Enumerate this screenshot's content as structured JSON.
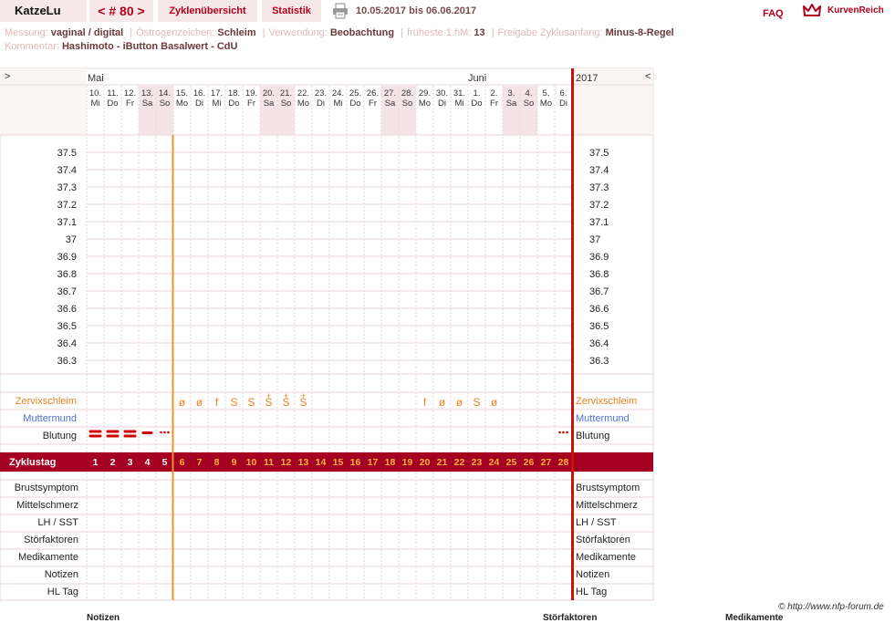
{
  "header": {
    "user": "KatzeLu",
    "cycle_nav": "< # 80 >",
    "tabs": [
      "Zyklenübersicht",
      "Statistik"
    ],
    "date_range": "10.05.2017 bis 06.06.2017",
    "faq": "FAQ",
    "brand": "KurvenReich",
    "printer_icon": "printer-icon",
    "crown_icon": "crown-icon"
  },
  "meta": {
    "line1": [
      {
        "key": "Messung:",
        "value": "vaginal / digital"
      },
      {
        "key": "Östrogenzeichen:",
        "value": "Schleim"
      },
      {
        "key": "Verwendung:",
        "value": "Beobachtung"
      },
      {
        "key": "früheste 1.hM:",
        "value": "13"
      },
      {
        "key": "Freigabe Zyklusanfang:",
        "value": "Minus-8-Regel"
      }
    ],
    "line2": [
      {
        "key": "Kommentar:",
        "value": "Hashimoto - iButton Basalwert - CdU"
      }
    ]
  },
  "chart": {
    "nav_left": ">",
    "nav_right": "<",
    "year": "2017",
    "month_may": "Mai",
    "month_june": "Juni",
    "days": [
      {
        "d": "10.",
        "w": "Mi",
        "we": false
      },
      {
        "d": "11.",
        "w": "Do",
        "we": false
      },
      {
        "d": "12.",
        "w": "Fr",
        "we": false
      },
      {
        "d": "13.",
        "w": "Sa",
        "we": true
      },
      {
        "d": "14.",
        "w": "So",
        "we": true
      },
      {
        "d": "15.",
        "w": "Mo",
        "we": false
      },
      {
        "d": "16.",
        "w": "Di",
        "we": false
      },
      {
        "d": "17.",
        "w": "Mi",
        "we": false
      },
      {
        "d": "18.",
        "w": "Do",
        "we": false
      },
      {
        "d": "19.",
        "w": "Fr",
        "we": false
      },
      {
        "d": "20.",
        "w": "Sa",
        "we": true
      },
      {
        "d": "21.",
        "w": "So",
        "we": true
      },
      {
        "d": "22.",
        "w": "Mo",
        "we": false
      },
      {
        "d": "23.",
        "w": "Di",
        "we": false
      },
      {
        "d": "24.",
        "w": "Mi",
        "we": false
      },
      {
        "d": "25.",
        "w": "Do",
        "we": false
      },
      {
        "d": "26.",
        "w": "Fr",
        "we": false
      },
      {
        "d": "27.",
        "w": "Sa",
        "we": true
      },
      {
        "d": "28.",
        "w": "So",
        "we": true
      },
      {
        "d": "29.",
        "w": "Mo",
        "we": false
      },
      {
        "d": "30.",
        "w": "Di",
        "we": false
      },
      {
        "d": "31.",
        "w": "Mi",
        "we": false
      },
      {
        "d": "1.",
        "w": "Do",
        "we": false
      },
      {
        "d": "2.",
        "w": "Fr",
        "we": false
      },
      {
        "d": "3.",
        "w": "Sa",
        "we": true
      },
      {
        "d": "4.",
        "w": "So",
        "we": true
      },
      {
        "d": "5.",
        "w": "Mo",
        "we": false
      },
      {
        "d": "6.",
        "w": "Di",
        "we": false
      }
    ],
    "temp_scale": [
      "37.5",
      "37.4",
      "37.3",
      "37.2",
      "37.1",
      "37",
      "36.9",
      "36.8",
      "36.7",
      "36.6",
      "36.5",
      "36.4",
      "36.3"
    ],
    "mucus_label": "Zervixschleim",
    "mucus": [
      "",
      "",
      "",
      "",
      "",
      "ø",
      "ø",
      "f",
      "S",
      "S",
      "S+",
      "S+",
      "S+",
      "",
      "",
      "",
      "",
      "",
      "",
      "f",
      "ø",
      "ø",
      "S",
      "ø",
      "",
      "",
      "",
      ""
    ],
    "cervix_label": "Muttermund",
    "bleeding_label": "Blutung",
    "bleeding": [
      "heavy",
      "heavy",
      "heavy",
      "medium",
      "spotting",
      "",
      "",
      "",
      "",
      "",
      "",
      "",
      "",
      "",
      "",
      "",
      "",
      "",
      "",
      "",
      "",
      "",
      "",
      "",
      "",
      "",
      "",
      "spotting"
    ],
    "cycle_day_label": "Zyklustag",
    "cycle_days": [
      "1",
      "2",
      "3",
      "4",
      "5",
      "6",
      "7",
      "8",
      "9",
      "10",
      "11",
      "12",
      "13",
      "14",
      "15",
      "16",
      "17",
      "18",
      "19",
      "20",
      "21",
      "22",
      "23",
      "24",
      "25",
      "26",
      "27",
      "28"
    ],
    "extra_rows": [
      "Brustsymptom",
      "Mittelschmerz",
      "LH / SST",
      "Störfaktoren",
      "Medikamente",
      "Notizen",
      "HL Tag"
    ],
    "colors": {
      "accent": "#b0001a",
      "cycle_bar": "#a50021",
      "mucus": "#e8821e",
      "cervix": "#4f6fd1",
      "weekend": "#f4e4e8",
      "grid": "#ead6d6",
      "cycle_start_line": "#f39028"
    }
  },
  "footer": {
    "copyright": "© http://www.nfp-forum.de",
    "col1": "Notizen",
    "col2": "Störfaktoren",
    "col3": "Medikamente"
  }
}
